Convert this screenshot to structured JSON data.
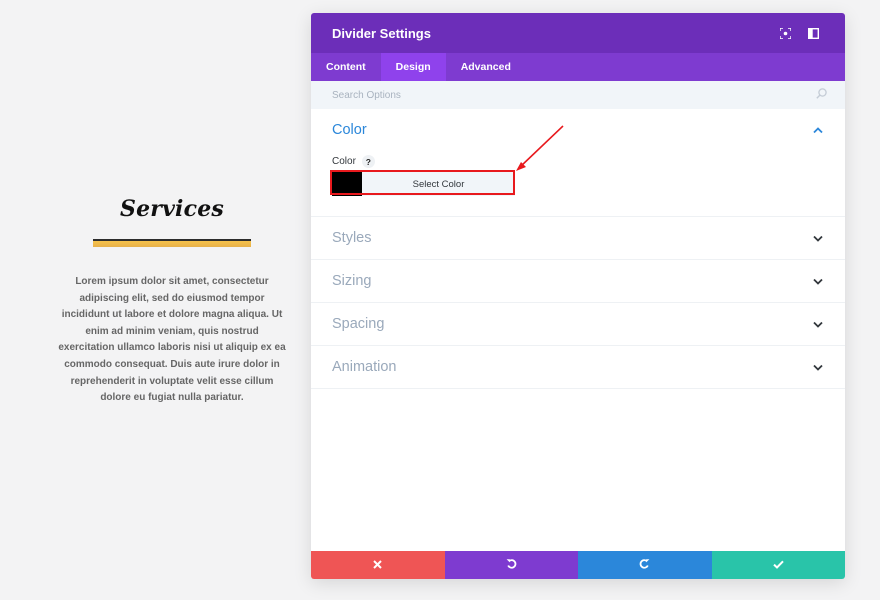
{
  "preview": {
    "title": "Services",
    "body": "Lorem ipsum dolor sit amet, consectetur adipiscing elit, sed do eiusmod tempor incididunt ut labore et dolore magna aliqua. Ut enim ad minim veniam, quis nostrud exercitation ullamco laboris nisi ut aliquip ex ea commodo consequat. Duis aute irure dolor in reprehenderit in voluptate velit esse cillum dolore eu fugiat nulla pariatur."
  },
  "modal": {
    "title": "Divider Settings",
    "header_icons": [
      "focus-icon",
      "sidebar-toggle-icon"
    ]
  },
  "tabs": [
    {
      "label": "Content",
      "active": false
    },
    {
      "label": "Design",
      "active": true
    },
    {
      "label": "Advanced",
      "active": false
    }
  ],
  "search": {
    "placeholder": "Search Options"
  },
  "sections": {
    "color": {
      "title": "Color",
      "field_label": "Color",
      "help": "?",
      "swatch_color": "#000000",
      "select_label": "Select Color"
    },
    "styles": {
      "title": "Styles"
    },
    "sizing": {
      "title": "Sizing"
    },
    "spacing": {
      "title": "Spacing"
    },
    "animation": {
      "title": "Animation"
    }
  },
  "footer": {
    "buttons": [
      "discard-icon",
      "undo-icon",
      "redo-icon",
      "save-check-icon"
    ]
  },
  "colors": {
    "header": "#6c2eb9",
    "tabs": "#7e3bd0",
    "active_tab": "#8f42ec",
    "open_section": "#2b87da",
    "highlight": "#e8191d",
    "discard": "#ef5555",
    "undo": "#7e3bd0",
    "redo": "#2b87da",
    "save": "#29c4a9"
  }
}
